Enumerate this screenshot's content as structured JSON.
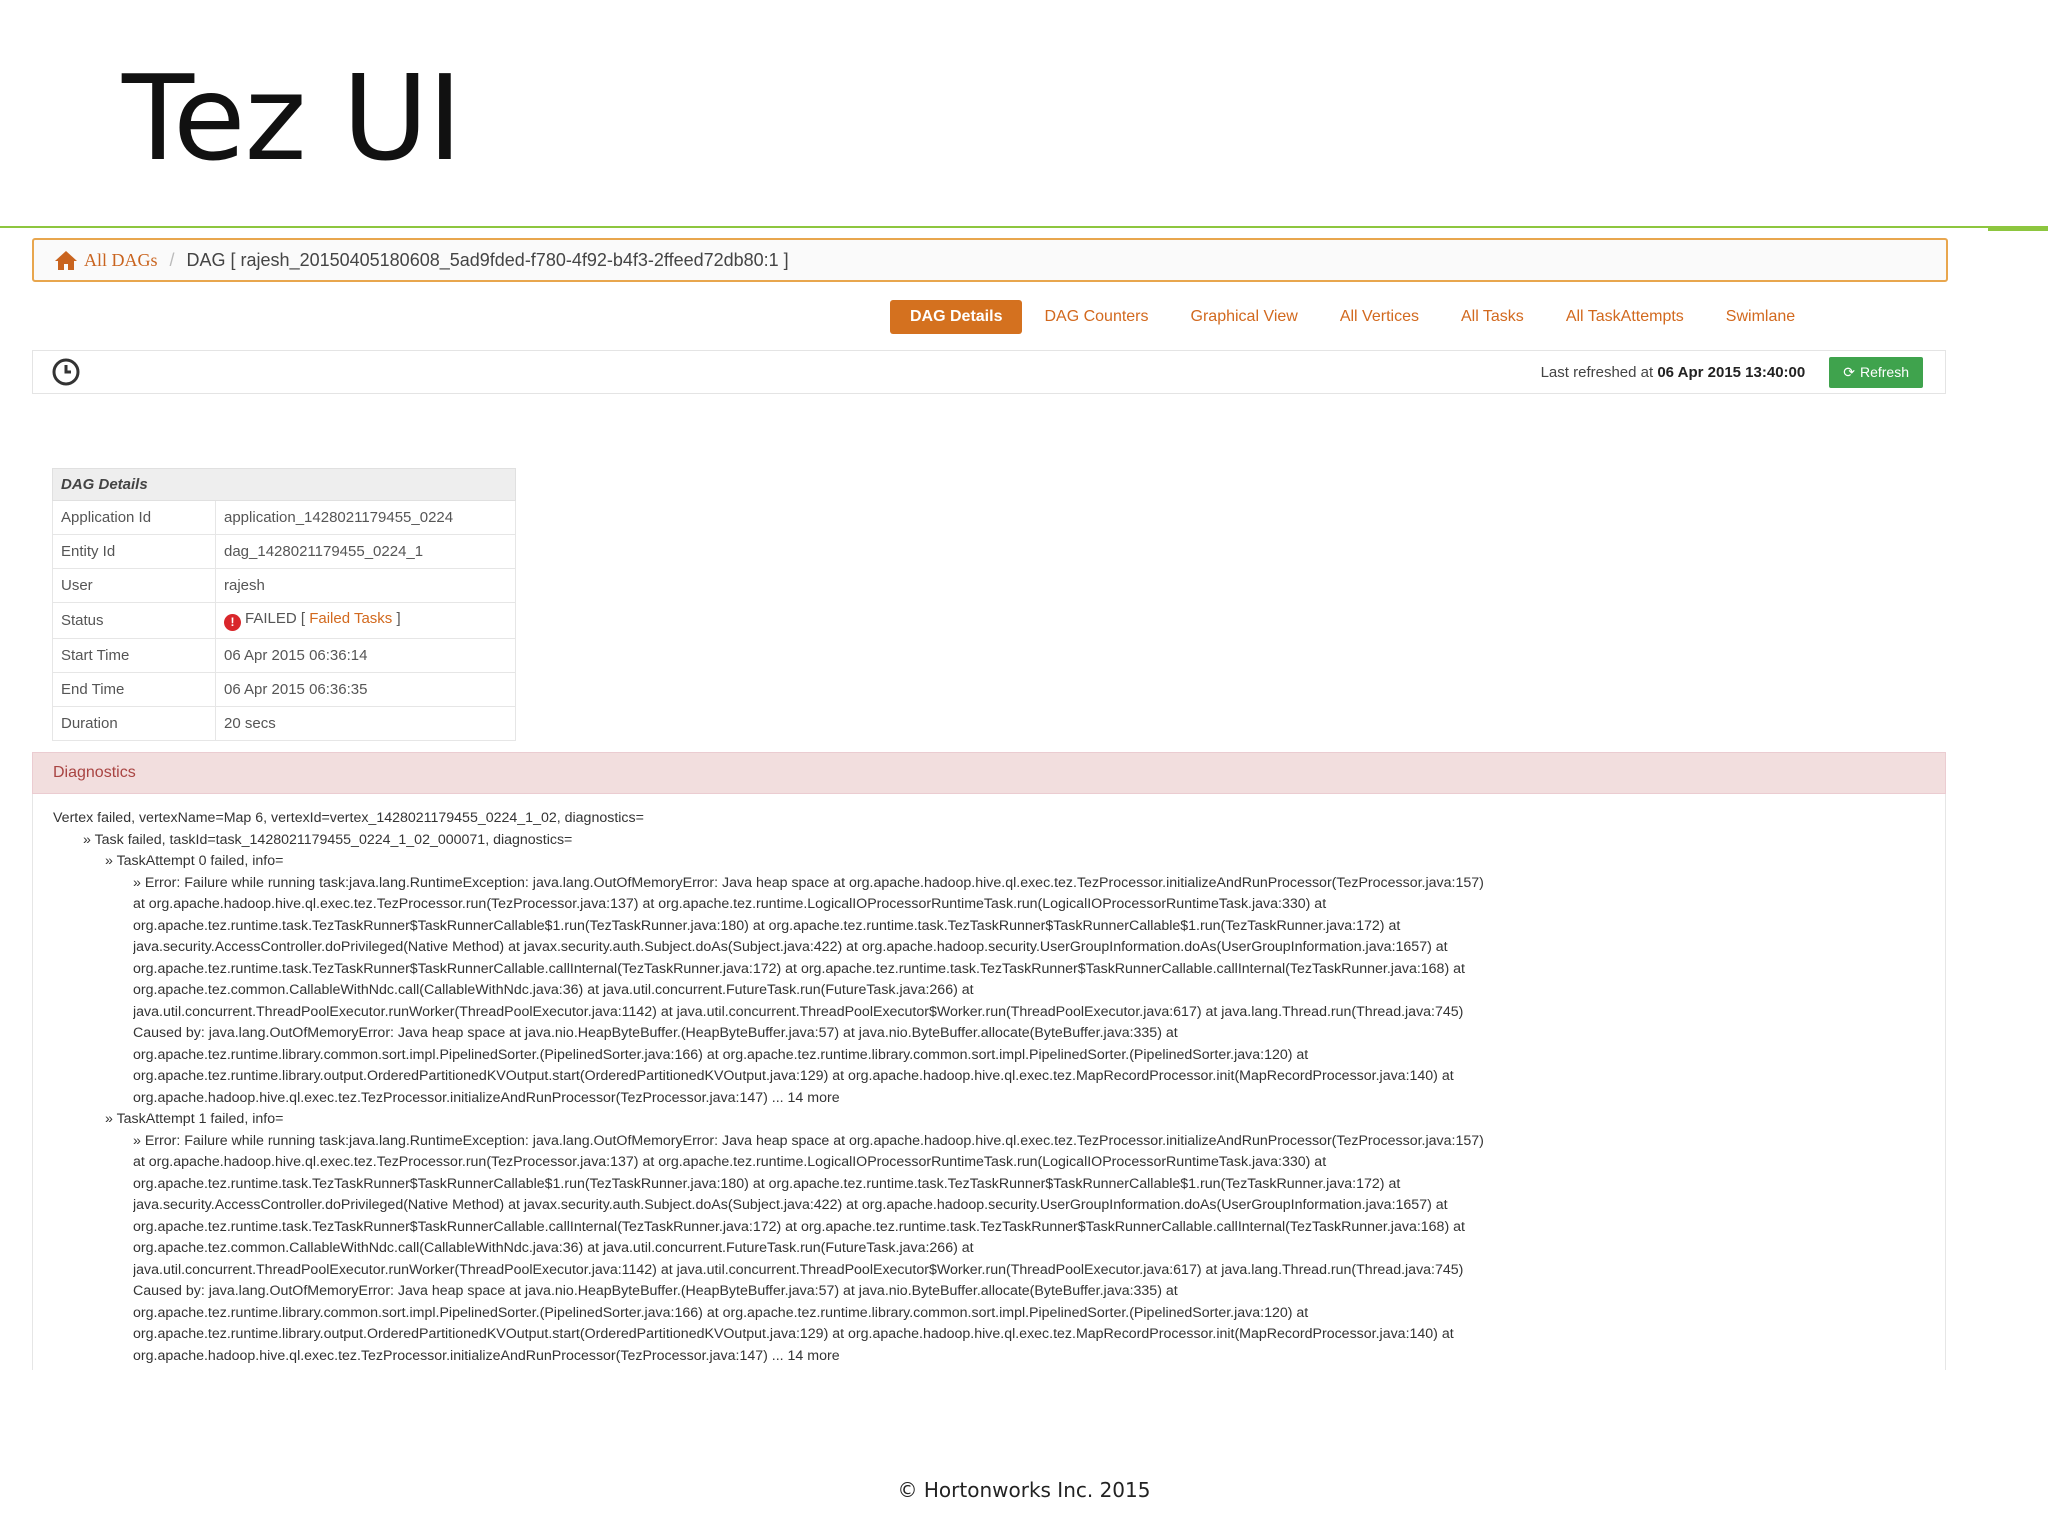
{
  "slide": {
    "title": "Tez UI",
    "footer": "© Hortonworks Inc. 2015",
    "accent_color": "#8dc63f"
  },
  "breadcrumb": {
    "home_icon": "home-icon",
    "root_label": "All DAGs",
    "separator": "/",
    "current": "DAG [ rajesh_20150405180608_5ad9fded-f780-4f92-b4f3-2ffeed72db80:1 ]"
  },
  "tabs": [
    {
      "label": "DAG Details",
      "active": true
    },
    {
      "label": "DAG Counters",
      "active": false
    },
    {
      "label": "Graphical View",
      "active": false
    },
    {
      "label": "All Vertices",
      "active": false
    },
    {
      "label": "All Tasks",
      "active": false
    },
    {
      "label": "All TaskAttempts",
      "active": false
    },
    {
      "label": "Swimlane",
      "active": false
    }
  ],
  "refresh": {
    "clock_icon": "clock-icon",
    "last_refreshed_label": "Last refreshed at",
    "last_refreshed_value": "06 Apr 2015 13:40:00",
    "button_label": "Refresh",
    "button_color": "#3fa34d"
  },
  "details": {
    "heading": "DAG Details",
    "application_id_label": "Application Id",
    "application_id": "application_1428021179455_0224",
    "entity_id_label": "Entity Id",
    "entity_id": "dag_1428021179455_0224_1",
    "user_label": "User",
    "user": "rajesh",
    "status_label": "Status",
    "status": "FAILED",
    "status_bracket_open": "[",
    "status_link": "Failed Tasks",
    "status_bracket_close": "]",
    "status_color": "#d9262b",
    "start_time_label": "Start Time",
    "start_time": "06 Apr 2015 06:36:14",
    "end_time_label": "End Time",
    "end_time": "06 Apr 2015 06:36:35",
    "duration_label": "Duration",
    "duration": "20 secs"
  },
  "diagnostics": {
    "heading": "Diagnostics",
    "vertex_line": "Vertex failed, vertexName=Map 6, vertexId=vertex_1428021179455_0224_1_02, diagnostics=",
    "task_line": "» Task failed, taskId=task_1428021179455_0224_1_02_000071, diagnostics=",
    "attempts": [
      {
        "header": "» TaskAttempt 0 failed, info=",
        "lines": [
          "» Error: Failure while running task:java.lang.RuntimeException: java.lang.OutOfMemoryError: Java heap space at org.apache.hadoop.hive.ql.exec.tez.TezProcessor.initializeAndRunProcessor(TezProcessor.java:157)",
          "at org.apache.hadoop.hive.ql.exec.tez.TezProcessor.run(TezProcessor.java:137) at org.apache.tez.runtime.LogicalIOProcessorRuntimeTask.run(LogicalIOProcessorRuntimeTask.java:330) at",
          "org.apache.tez.runtime.task.TezTaskRunner$TaskRunnerCallable$1.run(TezTaskRunner.java:180) at org.apache.tez.runtime.task.TezTaskRunner$TaskRunnerCallable$1.run(TezTaskRunner.java:172) at",
          "java.security.AccessController.doPrivileged(Native Method) at javax.security.auth.Subject.doAs(Subject.java:422) at org.apache.hadoop.security.UserGroupInformation.doAs(UserGroupInformation.java:1657) at",
          "org.apache.tez.runtime.task.TezTaskRunner$TaskRunnerCallable.callInternal(TezTaskRunner.java:172) at org.apache.tez.runtime.task.TezTaskRunner$TaskRunnerCallable.callInternal(TezTaskRunner.java:168) at",
          "org.apache.tez.common.CallableWithNdc.call(CallableWithNdc.java:36) at java.util.concurrent.FutureTask.run(FutureTask.java:266) at",
          "java.util.concurrent.ThreadPoolExecutor.runWorker(ThreadPoolExecutor.java:1142) at java.util.concurrent.ThreadPoolExecutor$Worker.run(ThreadPoolExecutor.java:617) at java.lang.Thread.run(Thread.java:745)",
          "Caused by: java.lang.OutOfMemoryError: Java heap space at java.nio.HeapByteBuffer.(HeapByteBuffer.java:57) at java.nio.ByteBuffer.allocate(ByteBuffer.java:335) at",
          "org.apache.tez.runtime.library.common.sort.impl.PipelinedSorter.(PipelinedSorter.java:166) at org.apache.tez.runtime.library.common.sort.impl.PipelinedSorter.(PipelinedSorter.java:120) at",
          "org.apache.tez.runtime.library.output.OrderedPartitionedKVOutput.start(OrderedPartitionedKVOutput.java:129) at org.apache.hadoop.hive.ql.exec.tez.MapRecordProcessor.init(MapRecordProcessor.java:140) at",
          "org.apache.hadoop.hive.ql.exec.tez.TezProcessor.initializeAndRunProcessor(TezProcessor.java:147) ... 14 more"
        ]
      },
      {
        "header": "» TaskAttempt 1 failed, info=",
        "lines": [
          "» Error: Failure while running task:java.lang.RuntimeException: java.lang.OutOfMemoryError: Java heap space at org.apache.hadoop.hive.ql.exec.tez.TezProcessor.initializeAndRunProcessor(TezProcessor.java:157)",
          "at org.apache.hadoop.hive.ql.exec.tez.TezProcessor.run(TezProcessor.java:137) at org.apache.tez.runtime.LogicalIOProcessorRuntimeTask.run(LogicalIOProcessorRuntimeTask.java:330) at",
          "org.apache.tez.runtime.task.TezTaskRunner$TaskRunnerCallable$1.run(TezTaskRunner.java:180) at org.apache.tez.runtime.task.TezTaskRunner$TaskRunnerCallable$1.run(TezTaskRunner.java:172) at",
          "java.security.AccessController.doPrivileged(Native Method) at javax.security.auth.Subject.doAs(Subject.java:422) at org.apache.hadoop.security.UserGroupInformation.doAs(UserGroupInformation.java:1657) at",
          "org.apache.tez.runtime.task.TezTaskRunner$TaskRunnerCallable.callInternal(TezTaskRunner.java:172) at org.apache.tez.runtime.task.TezTaskRunner$TaskRunnerCallable.callInternal(TezTaskRunner.java:168) at",
          "org.apache.tez.common.CallableWithNdc.call(CallableWithNdc.java:36) at java.util.concurrent.FutureTask.run(FutureTask.java:266) at",
          "java.util.concurrent.ThreadPoolExecutor.runWorker(ThreadPoolExecutor.java:1142) at java.util.concurrent.ThreadPoolExecutor$Worker.run(ThreadPoolExecutor.java:617) at java.lang.Thread.run(Thread.java:745)",
          "Caused by: java.lang.OutOfMemoryError: Java heap space at java.nio.HeapByteBuffer.(HeapByteBuffer.java:57) at java.nio.ByteBuffer.allocate(ByteBuffer.java:335) at",
          "org.apache.tez.runtime.library.common.sort.impl.PipelinedSorter.(PipelinedSorter.java:166) at org.apache.tez.runtime.library.common.sort.impl.PipelinedSorter.(PipelinedSorter.java:120) at",
          "org.apache.tez.runtime.library.output.OrderedPartitionedKVOutput.start(OrderedPartitionedKVOutput.java:129) at org.apache.hadoop.hive.ql.exec.tez.MapRecordProcessor.init(MapRecordProcessor.java:140) at",
          "org.apache.hadoop.hive.ql.exec.tez.TezProcessor.initializeAndRunProcessor(TezProcessor.java:147) ... 14 more"
        ]
      }
    ]
  }
}
